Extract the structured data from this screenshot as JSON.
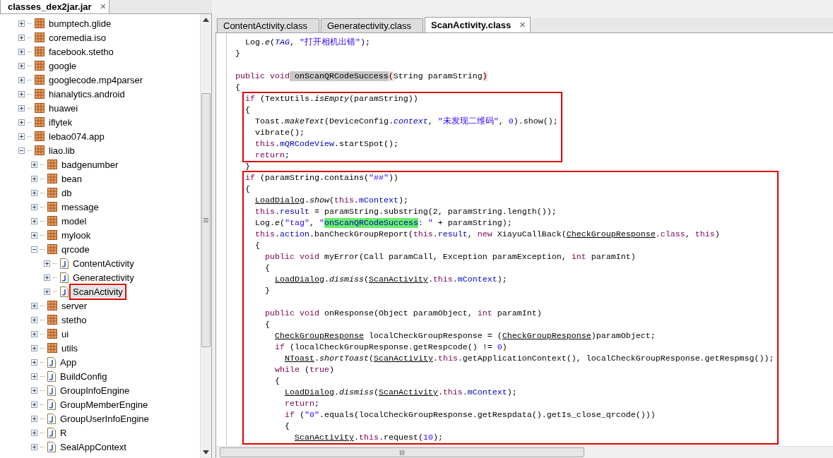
{
  "left_panel": {
    "tab": {
      "label": "classes_dex2jar.jar",
      "close": "×",
      "selected": true
    },
    "tree": [
      {
        "label": "bumptech.glide",
        "kind": "package",
        "expanded": false,
        "selected": false
      },
      {
        "label": "coremedia.iso",
        "kind": "package",
        "expanded": false,
        "selected": false
      },
      {
        "label": "facebook.stetho",
        "kind": "package",
        "expanded": false,
        "selected": false
      },
      {
        "label": "google",
        "kind": "package",
        "expanded": false,
        "selected": false
      },
      {
        "label": "googlecode.mp4parser",
        "kind": "package",
        "expanded": false,
        "selected": false
      },
      {
        "label": "hianalytics.android",
        "kind": "package",
        "expanded": false,
        "selected": false
      },
      {
        "label": "huawei",
        "kind": "package",
        "expanded": false,
        "selected": false
      },
      {
        "label": "iflytek",
        "kind": "package",
        "expanded": false,
        "selected": false
      },
      {
        "label": "lebao074.app",
        "kind": "package",
        "expanded": false,
        "selected": false
      },
      {
        "label": "liao.lib",
        "kind": "package",
        "expanded": true,
        "selected": false,
        "children": [
          {
            "label": "badgenumber",
            "kind": "package",
            "expanded": false,
            "selected": false
          },
          {
            "label": "bean",
            "kind": "package",
            "expanded": false,
            "selected": false
          },
          {
            "label": "db",
            "kind": "package",
            "expanded": false,
            "selected": false
          },
          {
            "label": "message",
            "kind": "package",
            "expanded": false,
            "selected": false
          },
          {
            "label": "model",
            "kind": "package",
            "expanded": false,
            "selected": false
          },
          {
            "label": "mylook",
            "kind": "package",
            "expanded": false,
            "selected": false
          },
          {
            "label": "qrcode",
            "kind": "package",
            "expanded": true,
            "selected": false,
            "children": [
              {
                "label": "ContentActivity",
                "kind": "class",
                "expanded": false,
                "selected": false
              },
              {
                "label": "Generatectivity",
                "kind": "class",
                "expanded": false,
                "selected": false
              },
              {
                "label": "ScanActivity",
                "kind": "class",
                "expanded": false,
                "selected": true
              }
            ]
          },
          {
            "label": "server",
            "kind": "package",
            "expanded": false,
            "selected": false
          },
          {
            "label": "stetho",
            "kind": "package",
            "expanded": false,
            "selected": false
          },
          {
            "label": "ui",
            "kind": "package",
            "expanded": false,
            "selected": false
          },
          {
            "label": "utils",
            "kind": "package",
            "expanded": false,
            "selected": false
          },
          {
            "label": "App",
            "kind": "class",
            "expanded": false,
            "selected": false
          },
          {
            "label": "BuildConfig",
            "kind": "class",
            "expanded": false,
            "selected": false
          },
          {
            "label": "GroupInfoEngine",
            "kind": "class",
            "expanded": false,
            "selected": false
          },
          {
            "label": "GroupMemberEngine",
            "kind": "class",
            "expanded": false,
            "selected": false
          },
          {
            "label": "GroupUserInfoEngine",
            "kind": "class",
            "expanded": false,
            "selected": false
          },
          {
            "label": "R",
            "kind": "class",
            "expanded": false,
            "selected": false
          },
          {
            "label": "SealAppContext",
            "kind": "class",
            "expanded": false,
            "selected": false
          }
        ]
      }
    ]
  },
  "editor": {
    "tabs": [
      {
        "label": "ContentActivity.class",
        "selected": false
      },
      {
        "label": "Generatectivity.class",
        "selected": false
      },
      {
        "label": "ScanActivity.class",
        "selected": true,
        "close": "×"
      }
    ],
    "blocks": [
      {
        "boxed": false,
        "lines": [
          {
            "kind": "outer",
            "children": [
              {
                "kind": "code",
                "tokens": [
                  {
                    "text": "Log.",
                    "kind": "plain"
                  },
                  {
                    "text": "e",
                    "kind": "smethod"
                  },
                  {
                    "text": "(",
                    "kind": "plain"
                  },
                  {
                    "text": "TAG",
                    "kind": "sfield"
                  },
                  {
                    "text": ",",
                    "kind": "plain"
                  },
                  {
                    "text": " \"打开相机出错\"",
                    "kind": "str"
                  },
                  {
                    "text": ");",
                    "kind": "plain"
                  }
                ]
              }
            ]
          },
          {
            "kind": "code",
            "tokens": [
              {
                "text": "}",
                "kind": "plain"
              }
            ]
          },
          {
            "kind": "blank"
          },
          {
            "kind": "code",
            "tokens": [
              {
                "text": "public void",
                "kind": "kw"
              },
              {
                "text": " onScanQRCodeSuccess",
                "kind": "selection"
              },
              {
                "text": "(",
                "kind": "bracket"
              },
              {
                "text": "String paramString",
                "kind": "plain"
              },
              {
                "text": ")",
                "kind": "bracket"
              }
            ]
          },
          {
            "kind": "code",
            "tokens": [
              {
                "text": "{",
                "kind": "plain"
              }
            ]
          }
        ]
      },
      {
        "boxed": true,
        "lines": [
          {
            "kind": "code",
            "tokens": [
              {
                "text": "if",
                "kind": "kw"
              },
              {
                "text": " (TextUtils.",
                "kind": "plain"
              },
              {
                "text": "isEmpty",
                "kind": "smethod"
              },
              {
                "text": "(paramString))",
                "kind": "plain"
              }
            ]
          },
          {
            "kind": "code",
            "tokens": [
              {
                "text": "{",
                "kind": "plain"
              }
            ],
            "children": [
              {
                "kind": "code",
                "tokens": [
                  {
                    "text": "Toast.",
                    "kind": "plain"
                  },
                  {
                    "text": "makeText",
                    "kind": "smethod"
                  },
                  {
                    "text": "(DeviceConfig.",
                    "kind": "plain"
                  },
                  {
                    "text": "context",
                    "kind": "sfield"
                  },
                  {
                    "text": ",",
                    "kind": "plain"
                  },
                  {
                    "text": " \"未发现二维码\"",
                    "kind": "str"
                  },
                  {
                    "text": ",",
                    "kind": "plain"
                  },
                  {
                    "text": " 0",
                    "kind": "num"
                  },
                  {
                    "text": ").show();",
                    "kind": "plain"
                  }
                ]
              },
              {
                "kind": "code",
                "tokens": [
                  {
                    "text": "vibrate();",
                    "kind": "plain"
                  }
                ]
              },
              {
                "kind": "code",
                "tokens": [
                  {
                    "text": "this",
                    "kind": "kw"
                  },
                  {
                    "text": ".",
                    "kind": "plain"
                  },
                  {
                    "text": "mQRCodeView",
                    "kind": "field"
                  },
                  {
                    "text": ".startSpot();",
                    "kind": "plain"
                  }
                ]
              },
              {
                "kind": "code",
                "tokens": [
                  {
                    "text": "return",
                    "kind": "kw"
                  },
                  {
                    "text": ";",
                    "kind": "plain"
                  }
                ]
              }
            ]
          }
        ]
      },
      {
        "boxed": false,
        "lines": [
          {
            "kind": "outer",
            "children": [
              {
                "kind": "code",
                "tokens": [
                  {
                    "text": "}",
                    "kind": "plain"
                  }
                ]
              }
            ]
          }
        ]
      },
      {
        "boxed": true,
        "lines": [
          {
            "kind": "code",
            "tokens": [
              {
                "text": "if",
                "kind": "kw"
              },
              {
                "text": " (paramString.contains(",
                "kind": "plain"
              },
              {
                "text": "\"##\"",
                "kind": "str"
              },
              {
                "text": "))",
                "kind": "plain"
              }
            ]
          },
          {
            "kind": "code",
            "tokens": [
              {
                "text": "{",
                "kind": "plain"
              }
            ],
            "children": [
              {
                "kind": "code",
                "tokens": [
                  {
                    "text": "LoadDialog",
                    "kind": "type"
                  },
                  {
                    "text": ".",
                    "kind": "plain"
                  },
                  {
                    "text": "show",
                    "kind": "smethod"
                  },
                  {
                    "text": "(",
                    "kind": "plain"
                  },
                  {
                    "text": "this",
                    "kind": "kw"
                  },
                  {
                    "text": ".",
                    "kind": "plain"
                  },
                  {
                    "text": "mContext",
                    "kind": "field"
                  },
                  {
                    "text": ");",
                    "kind": "plain"
                  }
                ]
              },
              {
                "kind": "code",
                "tokens": [
                  {
                    "text": "this",
                    "kind": "kw"
                  },
                  {
                    "text": ".",
                    "kind": "plain"
                  },
                  {
                    "text": "result",
                    "kind": "field"
                  },
                  {
                    "text": " = paramString.substring(2, paramString.length());",
                    "kind": "plain"
                  }
                ]
              },
              {
                "kind": "code",
                "tokens": [
                  {
                    "text": "Log.",
                    "kind": "plain"
                  },
                  {
                    "text": "e",
                    "kind": "smethod"
                  },
                  {
                    "text": "(",
                    "kind": "plain"
                  },
                  {
                    "text": "\"tag\"",
                    "kind": "str"
                  },
                  {
                    "text": ",",
                    "kind": "plain"
                  },
                  {
                    "text": " \"",
                    "kind": "str"
                  },
                  {
                    "text": "onScanQRCodeSuccess",
                    "kind": "match"
                  },
                  {
                    "text": ": \"",
                    "kind": "str"
                  },
                  {
                    "text": " + paramString);",
                    "kind": "plain"
                  }
                ]
              },
              {
                "kind": "code",
                "tokens": [
                  {
                    "text": "this",
                    "kind": "kw"
                  },
                  {
                    "text": ".",
                    "kind": "plain"
                  },
                  {
                    "text": "action",
                    "kind": "field"
                  },
                  {
                    "text": ".banCheckGroupReport(",
                    "kind": "plain"
                  },
                  {
                    "text": "this",
                    "kind": "kw"
                  },
                  {
                    "text": ".",
                    "kind": "plain"
                  },
                  {
                    "text": "result",
                    "kind": "field"
                  },
                  {
                    "text": ",",
                    "kind": "plain"
                  },
                  {
                    "text": " new",
                    "kind": "kw"
                  },
                  {
                    "text": " XiayuCallBack(",
                    "kind": "plain"
                  },
                  {
                    "text": "CheckGroupResponse",
                    "kind": "type"
                  },
                  {
                    "text": ".",
                    "kind": "plain"
                  },
                  {
                    "text": "class",
                    "kind": "kw"
                  },
                  {
                    "text": ",",
                    "kind": "plain"
                  },
                  {
                    "text": " this",
                    "kind": "kw"
                  },
                  {
                    "text": ")",
                    "kind": "plain"
                  }
                ]
              },
              {
                "kind": "code",
                "tokens": [
                  {
                    "text": "{",
                    "kind": "plain"
                  }
                ],
                "children": [
                  {
                    "kind": "code",
                    "tokens": [
                      {
                        "text": "public void",
                        "kind": "kw"
                      },
                      {
                        "text": " myError(Call paramCall, Exception paramException,",
                        "kind": "plain"
                      },
                      {
                        "text": " int",
                        "kind": "kw"
                      },
                      {
                        "text": " paramInt)",
                        "kind": "plain"
                      }
                    ]
                  },
                  {
                    "kind": "code",
                    "tokens": [
                      {
                        "text": "{",
                        "kind": "plain"
                      }
                    ],
                    "children": [
                      {
                        "kind": "code",
                        "tokens": [
                          {
                            "text": "LoadDialog",
                            "kind": "type"
                          },
                          {
                            "text": ".",
                            "kind": "plain"
                          },
                          {
                            "text": "dismiss",
                            "kind": "smethod"
                          },
                          {
                            "text": "(",
                            "kind": "plain"
                          },
                          {
                            "text": "ScanActivity",
                            "kind": "type"
                          },
                          {
                            "text": ".",
                            "kind": "plain"
                          },
                          {
                            "text": "this",
                            "kind": "kw"
                          },
                          {
                            "text": ".",
                            "kind": "plain"
                          },
                          {
                            "text": "mContext",
                            "kind": "field"
                          },
                          {
                            "text": ");",
                            "kind": "plain"
                          }
                        ]
                      }
                    ]
                  },
                  {
                    "kind": "code",
                    "tokens": [
                      {
                        "text": "}",
                        "kind": "plain"
                      }
                    ]
                  },
                  {
                    "kind": "blank"
                  },
                  {
                    "kind": "code",
                    "tokens": [
                      {
                        "text": "public void",
                        "kind": "kw"
                      },
                      {
                        "text": " onResponse(Object paramObject,",
                        "kind": "plain"
                      },
                      {
                        "text": " int",
                        "kind": "kw"
                      },
                      {
                        "text": " paramInt)",
                        "kind": "plain"
                      }
                    ]
                  },
                  {
                    "kind": "code",
                    "tokens": [
                      {
                        "text": "{",
                        "kind": "plain"
                      }
                    ],
                    "children": [
                      {
                        "kind": "code",
                        "tokens": [
                          {
                            "text": "CheckGroupResponse",
                            "kind": "type"
                          },
                          {
                            "text": " localCheckGroupResponse = (",
                            "kind": "plain"
                          },
                          {
                            "text": "CheckGroupResponse",
                            "kind": "type"
                          },
                          {
                            "text": ")paramObject;",
                            "kind": "plain"
                          }
                        ]
                      },
                      {
                        "kind": "code",
                        "tokens": [
                          {
                            "text": "if",
                            "kind": "kw"
                          },
                          {
                            "text": " (localCheckGroupResponse.getRespcode() !=",
                            "kind": "plain"
                          },
                          {
                            "text": " 0",
                            "kind": "num"
                          },
                          {
                            "text": ")",
                            "kind": "plain"
                          }
                        ],
                        "children": [
                          {
                            "kind": "code",
                            "tokens": [
                              {
                                "text": "NToast",
                                "kind": "type"
                              },
                              {
                                "text": ".",
                                "kind": "plain"
                              },
                              {
                                "text": "shortToast",
                                "kind": "smethod"
                              },
                              {
                                "text": "(",
                                "kind": "plain"
                              },
                              {
                                "text": "ScanActivity",
                                "kind": "type"
                              },
                              {
                                "text": ".",
                                "kind": "plain"
                              },
                              {
                                "text": "this",
                                "kind": "kw"
                              },
                              {
                                "text": ".getApplicationContext(), localCheckGroupResponse.getRespmsg());",
                                "kind": "plain"
                              }
                            ]
                          }
                        ]
                      },
                      {
                        "kind": "code",
                        "tokens": [
                          {
                            "text": "while",
                            "kind": "kw"
                          },
                          {
                            "text": " (",
                            "kind": "plain"
                          },
                          {
                            "text": "true",
                            "kind": "kw"
                          },
                          {
                            "text": ")",
                            "kind": "plain"
                          }
                        ]
                      },
                      {
                        "kind": "code",
                        "tokens": [
                          {
                            "text": "{",
                            "kind": "plain"
                          }
                        ],
                        "children": [
                          {
                            "kind": "code",
                            "tokens": [
                              {
                                "text": "LoadDialog",
                                "kind": "type"
                              },
                              {
                                "text": ".",
                                "kind": "plain"
                              },
                              {
                                "text": "dismiss",
                                "kind": "smethod"
                              },
                              {
                                "text": "(",
                                "kind": "plain"
                              },
                              {
                                "text": "ScanActivity",
                                "kind": "type"
                              },
                              {
                                "text": ".",
                                "kind": "plain"
                              },
                              {
                                "text": "this",
                                "kind": "kw"
                              },
                              {
                                "text": ".",
                                "kind": "plain"
                              },
                              {
                                "text": "mContext",
                                "kind": "field"
                              },
                              {
                                "text": ");",
                                "kind": "plain"
                              }
                            ]
                          },
                          {
                            "kind": "code",
                            "tokens": [
                              {
                                "text": "return",
                                "kind": "kw"
                              },
                              {
                                "text": ";",
                                "kind": "plain"
                              }
                            ]
                          },
                          {
                            "kind": "code",
                            "tokens": [
                              {
                                "text": "if",
                                "kind": "kw"
                              },
                              {
                                "text": " (",
                                "kind": "plain"
                              },
                              {
                                "text": "\"0\"",
                                "kind": "str"
                              },
                              {
                                "text": ".equals(localCheckGroupResponse.getRespdata().getIs_close_qrcode()))",
                                "kind": "plain"
                              }
                            ]
                          },
                          {
                            "kind": "code",
                            "tokens": [
                              {
                                "text": "{",
                                "kind": "plain"
                              }
                            ],
                            "children": [
                              {
                                "kind": "code",
                                "tokens": [
                                  {
                                    "text": "ScanActivity",
                                    "kind": "type"
                                  },
                                  {
                                    "text": ".",
                                    "kind": "plain"
                                  },
                                  {
                                    "text": "this",
                                    "kind": "kw"
                                  },
                                  {
                                    "text": ".request(",
                                    "kind": "plain"
                                  },
                                  {
                                    "text": "10",
                                    "kind": "num"
                                  },
                                  {
                                    "text": ");",
                                    "kind": "plain"
                                  }
                                ]
                              }
                            ]
                          }
                        ]
                      }
                    ]
                  }
                ]
              }
            ]
          }
        ]
      }
    ]
  }
}
